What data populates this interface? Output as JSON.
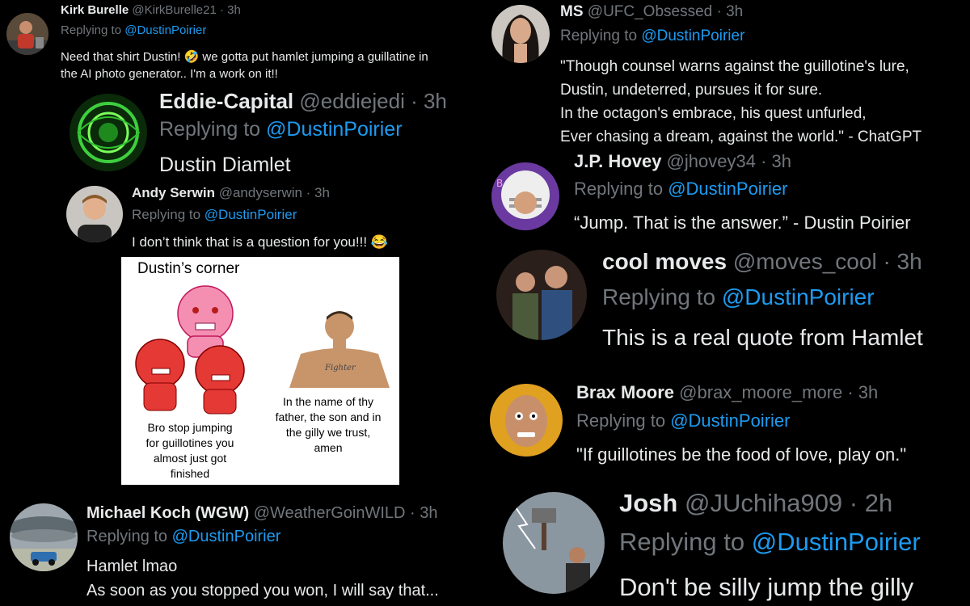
{
  "left": {
    "kirk": {
      "name": "Kirk Burelle",
      "handle": "@KirkBurelle21 · 3h",
      "reply_prefix": "Replying to",
      "reply_to": "@DustinPoirier",
      "text1": "Need that shirt Dustin! 🤣 we gotta put hamlet jumping a guillatine in",
      "text2": "the AI photo generator.. I'm a work on it!!"
    },
    "eddie": {
      "name": "Eddie-Capital",
      "handle": "@eddiejedi · 3h",
      "reply_prefix": "Replying to",
      "reply_to": "@DustinPoirier",
      "text": "Dustin Diamlet"
    },
    "andy": {
      "name": "Andy Serwin",
      "handle": "@andyserwin · 3h",
      "reply_prefix": "Replying to",
      "reply_to": "@DustinPoirier",
      "text": "I don’t think that is a question for you!!! 😂",
      "meme": {
        "title": "Dustin’s corner",
        "left_caption": [
          "Bro stop jumping",
          "for guillotines you",
          "almost just got",
          "finished"
        ],
        "right_caption": [
          "In the name of thy",
          "father, the son and in",
          "the gilly we trust,",
          "amen"
        ],
        "tattoo": "Fighter"
      }
    },
    "michael": {
      "name": "Michael Koch (WGW)",
      "handle": "@WeatherGoinWILD · 3h",
      "reply_prefix": "Replying to",
      "reply_to": "@DustinPoirier",
      "text1": "Hamlet lmao",
      "text2": "As soon as you stopped you won,  I will say that..."
    }
  },
  "right": {
    "ms": {
      "name": "MS",
      "handle": "@UFC_Obsessed · 3h",
      "reply_prefix": "Replying to",
      "reply_to": "@DustinPoirier",
      "lines": [
        "\"Though counsel warns against the guillotine's lure,",
        "Dustin, undeterred, pursues it for sure.",
        "In the octagon's embrace, his quest unfurled,",
        "Ever chasing a dream, against the world.\" - ChatGPT"
      ]
    },
    "jp": {
      "name": "J.P. Hovey",
      "handle": "@jhovey34 · 3h",
      "reply_prefix": "Replying to",
      "reply_to": "@DustinPoirier",
      "text": "“Jump. That is the answer.” - Dustin Poirier"
    },
    "cool": {
      "name": "cool moves",
      "handle": "@moves_cool · 3h",
      "reply_prefix": "Replying to",
      "reply_to": "@DustinPoirier",
      "text": "This is a real quote from Hamlet"
    },
    "brax": {
      "name": "Brax Moore",
      "handle": "@brax_moore_more · 3h",
      "reply_prefix": "Replying to",
      "reply_to": "@DustinPoirier",
      "text": "\"If guillotines be the food of love, play on.\""
    },
    "josh": {
      "name": "Josh",
      "handle": "@JUchiha909 · 2h",
      "reply_prefix": "Replying to",
      "reply_to": "@DustinPoirier",
      "text": "Don't be silly jump the gilly"
    }
  },
  "colors": {
    "background": "#000000",
    "text": "#e7e9ea",
    "muted": "#71767b",
    "mention": "#1d9bf0"
  }
}
